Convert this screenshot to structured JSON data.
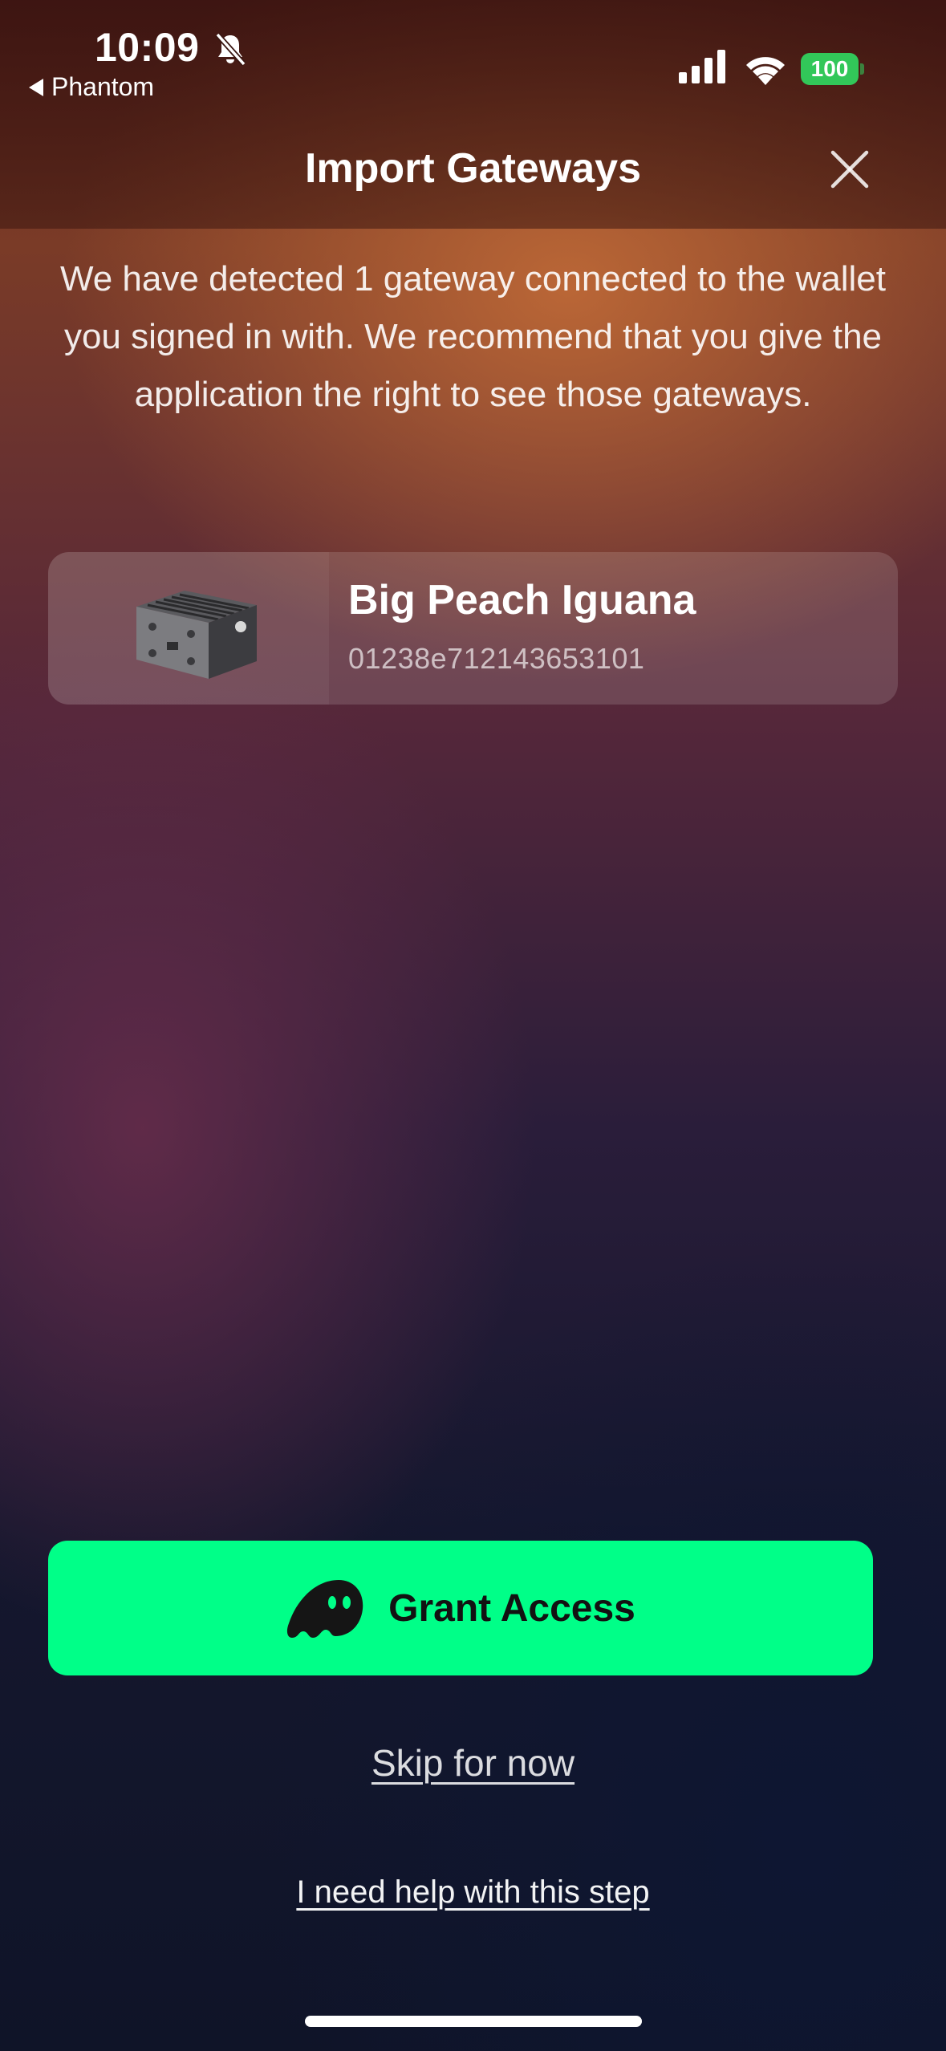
{
  "status_bar": {
    "time": "10:09",
    "back_app": "Phantom",
    "battery": "100",
    "icons": [
      "bell-slash-icon",
      "cellular-signal-icon",
      "wifi-icon",
      "battery-icon"
    ]
  },
  "header": {
    "title": "Import Gateways",
    "close_icon": "close-icon"
  },
  "intro_text": "We have detected 1 gateway connected to the wallet you signed in with. We recommend that you give the application the right to see those gateways.",
  "gateways": [
    {
      "name": "Big Peach Iguana",
      "id": "01238e712143653101",
      "image": "gateway-device-image"
    }
  ],
  "actions": {
    "grant_access": "Grant Access",
    "grant_icon": "phantom-ghost-icon",
    "skip": "Skip for now",
    "help": "I need help with this step"
  },
  "colors": {
    "accent": "#00ff88",
    "battery": "#32c759"
  }
}
